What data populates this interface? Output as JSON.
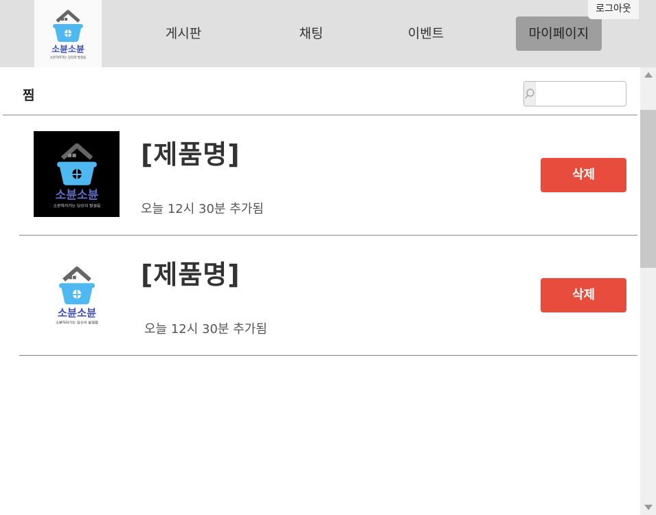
{
  "header": {
    "logo": {
      "title": "소뷴소뷴",
      "tagline": "소분하러가는 당신의 발걸음"
    },
    "nav": [
      {
        "label": "게시판"
      },
      {
        "label": "채팅"
      },
      {
        "label": "이벤트"
      },
      {
        "label": "마이페이지"
      }
    ],
    "logout_label": "로그아웃"
  },
  "section": {
    "title": "찜",
    "search": {
      "value": "",
      "placeholder": ""
    }
  },
  "items": [
    {
      "name": "[제품명]",
      "added": "오늘 12시 30분 추가됨",
      "delete_label": "삭제",
      "thumb_style": "dark"
    },
    {
      "name": "[제품명]",
      "added": "오늘 12시 30분 추가됨",
      "delete_label": "삭제",
      "thumb_style": "light"
    }
  ],
  "colors": {
    "header_bg": "#e0e0e0",
    "active_nav": "#9e9e9e",
    "delete": "#e74c3c",
    "logo_blue": "#4fb8f0",
    "logo_text": "#3f51b5"
  }
}
